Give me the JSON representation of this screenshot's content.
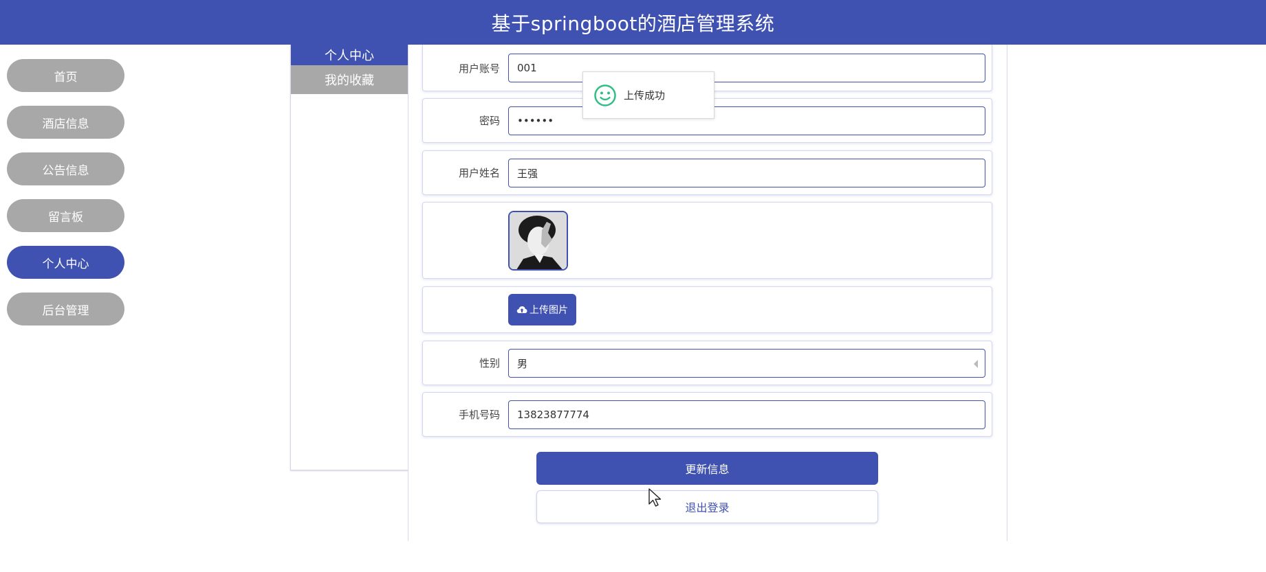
{
  "header": {
    "title": "基于springboot的酒店管理系统"
  },
  "nav": {
    "items": [
      {
        "label": "首页",
        "active": false
      },
      {
        "label": "酒店信息",
        "active": false
      },
      {
        "label": "公告信息",
        "active": false
      },
      {
        "label": "留言板",
        "active": false
      },
      {
        "label": "个人中心",
        "active": true
      },
      {
        "label": "后台管理",
        "active": false
      }
    ]
  },
  "submenu": {
    "items": [
      {
        "label": "个人中心",
        "active": true
      },
      {
        "label": "我的收藏",
        "active": false
      }
    ]
  },
  "form": {
    "account_label": "用户账号",
    "account_value": "001",
    "password_label": "密码",
    "password_value": "••••••",
    "name_label": "用户姓名",
    "name_value": "王强",
    "upload_label": "上传图片",
    "gender_label": "性别",
    "gender_value": "男",
    "phone_label": "手机号码",
    "phone_value": "13823877774",
    "update_label": "更新信息",
    "logout_label": "退出登录"
  },
  "toast": {
    "message": "上传成功"
  },
  "colors": {
    "primary": "#3f51b1",
    "nav_inactive": "#a8a8a8",
    "toast_icon": "#2fbf86"
  },
  "icons": {
    "upload": "cloud-upload-icon",
    "toast": "smiley-icon",
    "select": "caret-left-icon"
  }
}
